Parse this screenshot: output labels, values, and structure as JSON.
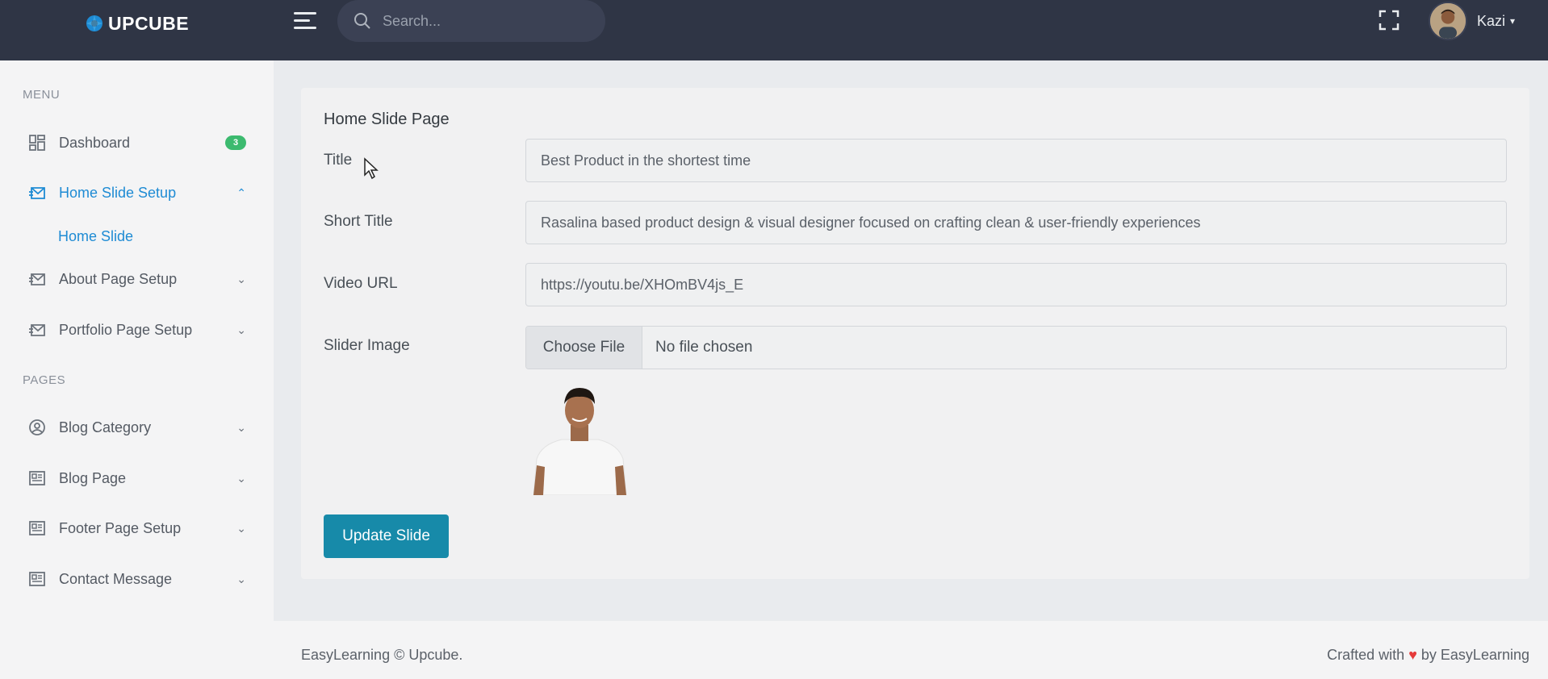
{
  "brand": {
    "name": "UPCUBE"
  },
  "topbar": {
    "search_placeholder": "Search...",
    "user_name": "Kazi",
    "icons": [
      "menu-icon",
      "search-icon",
      "fullscreen-icon",
      "chevron-down-icon"
    ]
  },
  "sidebar": {
    "menu_title": "MENU",
    "pages_title": "PAGES",
    "items": [
      {
        "label": "Dashboard",
        "icon": "dashboard-icon",
        "badge": "3"
      },
      {
        "label": "Home Slide Setup",
        "icon": "mail-icon",
        "active": true
      },
      {
        "label": "About Page Setup",
        "icon": "mail-icon"
      },
      {
        "label": "Portfolio Page Setup",
        "icon": "mail-icon"
      },
      {
        "label": "Blog Category",
        "icon": "user-circle-icon"
      },
      {
        "label": "Blog Page",
        "icon": "newspaper-icon"
      },
      {
        "label": "Footer Page Setup",
        "icon": "newspaper-icon"
      },
      {
        "label": "Contact Message",
        "icon": "newspaper-icon"
      }
    ],
    "subitem": "Home Slide"
  },
  "form": {
    "heading": "Home Slide Page",
    "title_label": "Title",
    "title_value": "Best Product in the shortest time",
    "short_title_label": "Short Title",
    "short_title_value": "Rasalina based product design & visual designer focused on crafting clean & user-friendly experiences",
    "video_url_label": "Video URL",
    "video_url_value": "https://youtu.be/XHOmBV4js_E",
    "slider_image_label": "Slider Image",
    "file_button": "Choose File",
    "file_status": "No file chosen",
    "submit": "Update Slide"
  },
  "footer": {
    "left": "EasyLearning © Upcube.",
    "right_prefix": "Crafted with",
    "heart": "♥",
    "right_suffix": "by EasyLearning"
  },
  "colors": {
    "topbar": "#2f3545",
    "accent": "#1e8bd4",
    "button": "#178aa9",
    "badge": "#3cba6f"
  }
}
